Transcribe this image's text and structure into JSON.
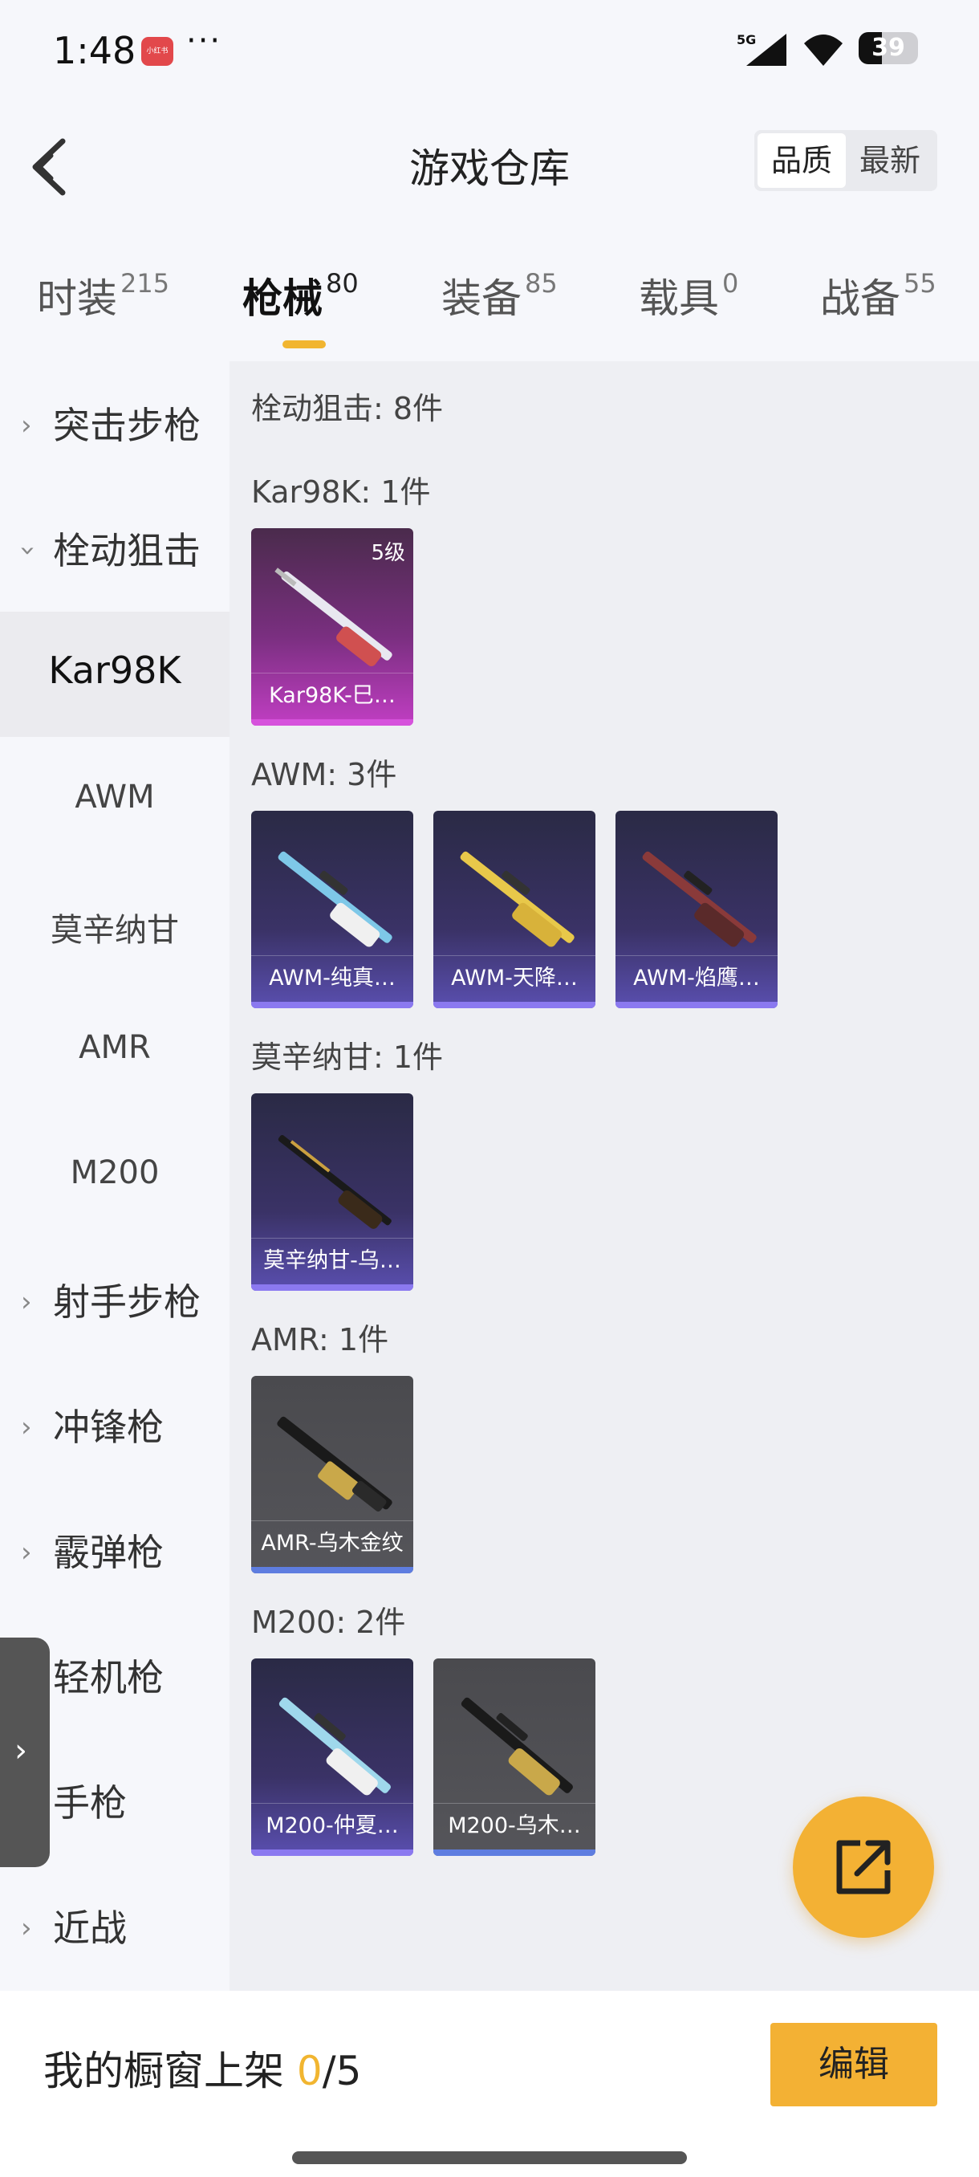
{
  "status_bar": {
    "time": "1:48",
    "app_badge": "小红书",
    "dots": "···",
    "network": "5G",
    "battery": "39",
    "battery_level": 0.39
  },
  "header": {
    "title": "游戏仓库",
    "sort_options": [
      "品质",
      "最新"
    ],
    "active_sort": "品质"
  },
  "tabs": [
    {
      "label": "时装",
      "count": "215"
    },
    {
      "label": "枪械",
      "count": "80",
      "active": true
    },
    {
      "label": "装备",
      "count": "85"
    },
    {
      "label": "载具",
      "count": "0"
    },
    {
      "label": "战备",
      "count": "55"
    }
  ],
  "sidebar": [
    {
      "label": "突击步枪",
      "type": "group",
      "expanded": false
    },
    {
      "label": "栓动狙击",
      "type": "group",
      "expanded": true
    },
    {
      "label": "Kar98K",
      "type": "sub",
      "selected": true
    },
    {
      "label": "AWM",
      "type": "sub"
    },
    {
      "label": "莫辛纳甘",
      "type": "sub"
    },
    {
      "label": "AMR",
      "type": "sub"
    },
    {
      "label": "M200",
      "type": "sub"
    },
    {
      "label": "射手步枪",
      "type": "group"
    },
    {
      "label": "冲锋枪",
      "type": "group"
    },
    {
      "label": "霰弹枪",
      "type": "group"
    },
    {
      "label": "轻机枪",
      "type": "group"
    },
    {
      "label": "手枪",
      "type": "group"
    },
    {
      "label": "近战",
      "type": "group"
    }
  ],
  "main": {
    "category_heading": "栓动狙击: 8件",
    "groups": [
      {
        "heading": "Kar98K: 1件",
        "items": [
          {
            "name": "Kar98K-巳…",
            "rarity": "pink",
            "level": "5级",
            "color": "#e8e8f0"
          }
        ]
      },
      {
        "heading": "AWM: 3件",
        "items": [
          {
            "name": "AWM-纯真…",
            "rarity": "purple",
            "color": "#7ec8e8"
          },
          {
            "name": "AWM-天降…",
            "rarity": "purple",
            "color": "#e8c84a"
          },
          {
            "name": "AWM-焰鹰…",
            "rarity": "purple",
            "color": "#8a3a3a"
          }
        ]
      },
      {
        "heading": "莫辛纳甘: 1件",
        "items": [
          {
            "name": "莫辛纳甘-乌…",
            "rarity": "purple",
            "color": "#caa040"
          }
        ]
      },
      {
        "heading": "AMR: 1件",
        "items": [
          {
            "name": "AMR-乌木金纹",
            "rarity": "grey",
            "color": "#c9a84a"
          }
        ]
      },
      {
        "heading": "M200: 2件",
        "items": [
          {
            "name": "M200-仲夏…",
            "rarity": "purple",
            "color": "#9fd8ec"
          },
          {
            "name": "M200-乌木…",
            "rarity": "grey",
            "color": "#c9a84a"
          }
        ]
      }
    ]
  },
  "bottom": {
    "label": "我的橱窗上架 ",
    "current": "0",
    "total": "/5",
    "edit_label": "编辑"
  },
  "icons": {
    "back": "back-arrow-icon",
    "share": "share-external-icon",
    "handle": "chevron-right-icon"
  },
  "colors": {
    "accent": "#f3b134",
    "pink_rarity": "#c13ec3",
    "purple_rarity": "#5a4fb0",
    "grey_rarity": "#55555a"
  }
}
